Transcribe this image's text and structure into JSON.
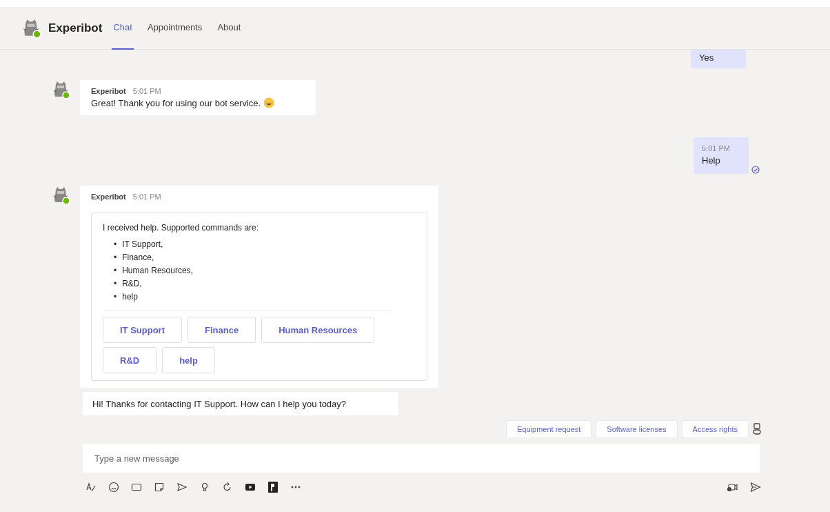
{
  "header": {
    "bot_name": "Experibot",
    "tabs": [
      {
        "label": "Chat",
        "selected": true
      },
      {
        "label": "Appointments",
        "selected": false
      },
      {
        "label": "About",
        "selected": false
      }
    ]
  },
  "messages": [
    {
      "kind": "user",
      "text": "Yes"
    },
    {
      "kind": "bot",
      "sender": "Experibot",
      "time": "5:01 PM",
      "text": "Great! Thank you for using our bot service.",
      "has_emoji": true
    },
    {
      "kind": "user",
      "time": "5:01 PM",
      "text": "Help",
      "seen": true
    },
    {
      "kind": "card",
      "sender": "Experibot",
      "time": "5:01 PM",
      "intro": "I received help. Supported commands are:",
      "items": [
        {
          "bullet": "•",
          "text": "IT Support,"
        },
        {
          "bullet": "•",
          "text": "Finance,"
        },
        {
          "bullet": "•",
          "text": "Human Resources,"
        },
        {
          "bullet": "•",
          "text": "R&D,"
        },
        {
          "bullet": "•",
          "text": "help"
        }
      ],
      "actions": [
        "IT Support",
        "Finance",
        "Human Resources",
        "R&D",
        "help"
      ]
    },
    {
      "kind": "plain",
      "text": "Hi! Thanks for contacting IT Support. How can I help you today?"
    }
  ],
  "suggested_actions": [
    "Equipment request",
    "Software licenses",
    "Access rights"
  ],
  "composer": {
    "placeholder": "Type a new message"
  }
}
